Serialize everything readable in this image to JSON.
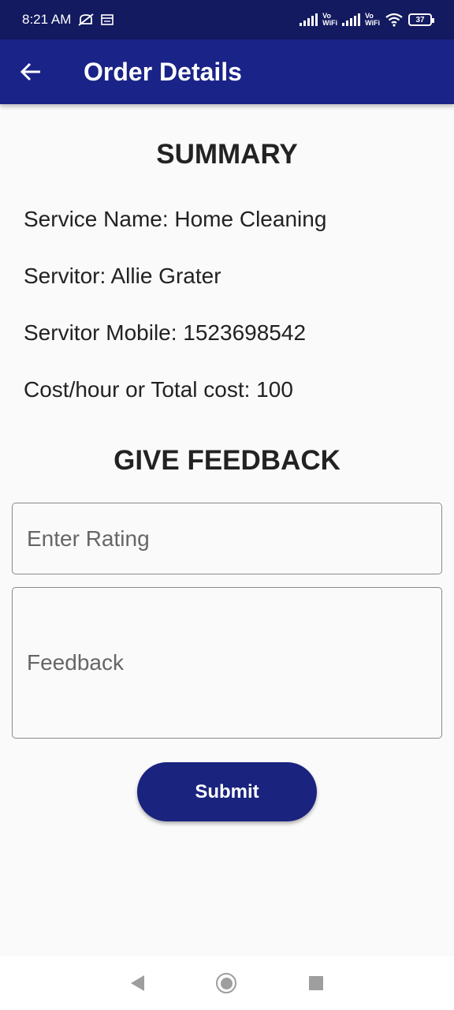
{
  "status_bar": {
    "time": "8:21 AM",
    "icons": [
      "mute-icon",
      "calendar-icon"
    ],
    "vowifi_top": "Vo",
    "vowifi_bottom": "WiFi",
    "battery": "37"
  },
  "app_bar": {
    "title": "Order Details",
    "back_icon": "back-arrow-icon",
    "color": "#1a2387"
  },
  "summary": {
    "title": "SUMMARY",
    "service_name": "Service Name: Home Cleaning",
    "servitor": "Servitor: Allie Grater",
    "servitor_mobile": "Servitor Mobile: 1523698542",
    "cost": "Cost/hour or Total cost: 100"
  },
  "feedback": {
    "title": "GIVE FEEDBACK",
    "rating_placeholder": "Enter Rating",
    "feedback_placeholder": "Feedback",
    "submit_label": "Submit"
  },
  "colors": {
    "primary": "#1a237e",
    "status_bar": "#131a5f",
    "background": "#fafafa"
  }
}
